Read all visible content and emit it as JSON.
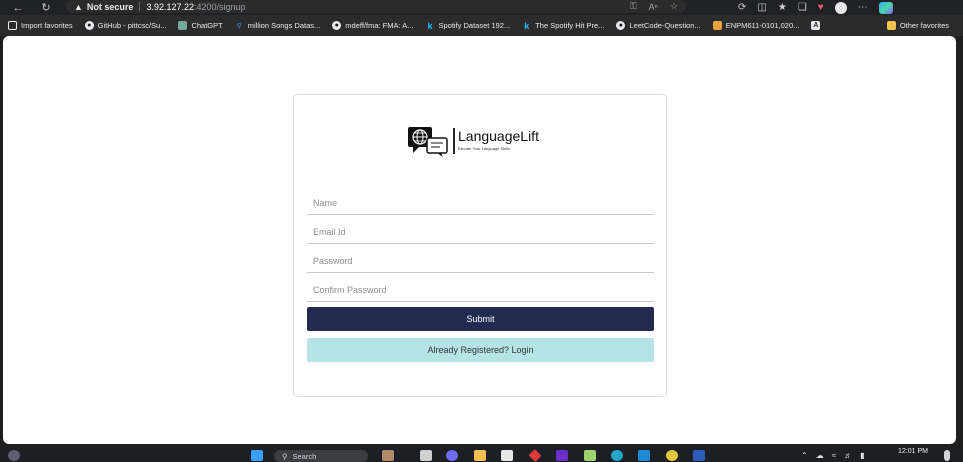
{
  "browser": {
    "security_label": "Not secure",
    "url_host": "3.92.127.22",
    "url_rest": ":4200/signup",
    "nav_icons": [
      "back-icon",
      "refresh-icon"
    ],
    "address_icons": [
      "key-icon",
      "read-aloud-icon",
      "favorite-star-icon"
    ],
    "toolbar_icons": [
      "extensions-icon",
      "split-screen-icon",
      "favorites-icon",
      "collections-icon",
      "heart-icon",
      "profile-avatar",
      "more-icon",
      "copilot-icon"
    ],
    "colors": {
      "frame": "#202124",
      "bookmark_bar": "#2b2b2b"
    }
  },
  "bookmarks": {
    "items": [
      {
        "label": "Import favorites",
        "icon": "import-icon"
      },
      {
        "label": "GitHub - pittcsc/Su...",
        "icon": "github-icon"
      },
      {
        "label": "ChatGPT",
        "icon": "chatgpt-icon"
      },
      {
        "label": "million Songs Datas...",
        "icon": "search-icon"
      },
      {
        "label": "mdeff/fma: FMA: A...",
        "icon": "github-icon"
      },
      {
        "label": "Spotify Dataset 192...",
        "icon": "kaggle-icon"
      },
      {
        "label": "The Spotify Hit Pre...",
        "icon": "kaggle-icon"
      },
      {
        "label": "LeetCode-Question...",
        "icon": "github-icon"
      },
      {
        "label": "ENPM611-0101,020...",
        "icon": "course-icon"
      },
      {
        "label": "",
        "icon": "a-icon"
      }
    ],
    "other": "Other favorites"
  },
  "signup": {
    "brand": "LanguageLift",
    "tagline": "Elevate Your Language Skills",
    "fields": {
      "name": {
        "placeholder": "Name",
        "value": ""
      },
      "email": {
        "placeholder": "Email Id",
        "value": ""
      },
      "password": {
        "placeholder": "Password",
        "value": ""
      },
      "confirm": {
        "placeholder": "Confirm Password",
        "value": ""
      }
    },
    "submit_label": "Submit",
    "login_label": "Already Registered? Login",
    "colors": {
      "submit_bg": "#222b4f",
      "login_bg": "#b5e3e6"
    }
  },
  "taskbar": {
    "search_placeholder": "Search",
    "time": "12:01 PM",
    "apps": [
      "start-icon",
      "search-icon",
      "file-explorer-icon",
      "chat-icon",
      "folder-icon",
      "store-icon",
      "app-icon",
      "prime-icon",
      "app-icon",
      "edge-icon",
      "vscode-icon",
      "chrome-icon",
      "word-icon"
    ]
  }
}
